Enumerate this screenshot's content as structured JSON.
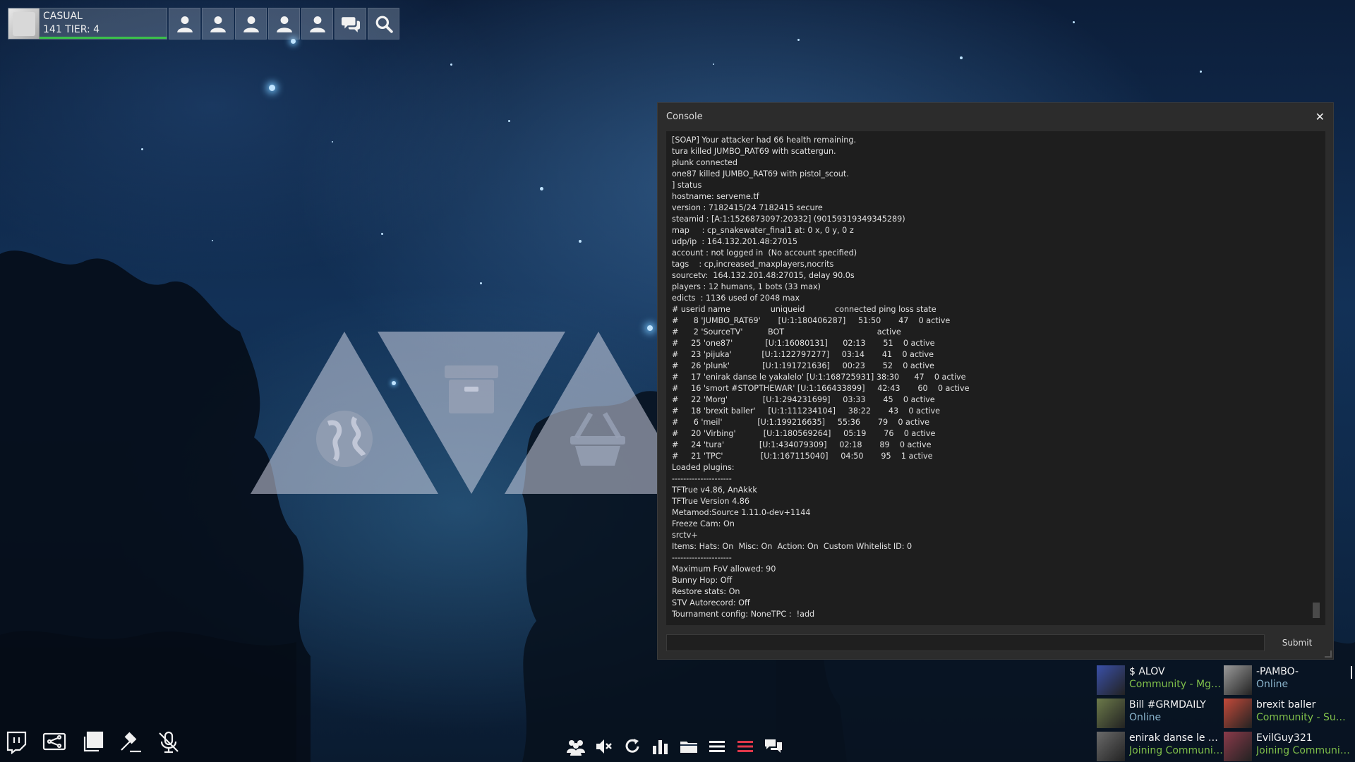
{
  "profile": {
    "mode": "CASUAL",
    "tier": "141 TIER: 4"
  },
  "topbar": {
    "buttons": [
      "person-icon",
      "person-icon",
      "person-icon",
      "person-icon",
      "person-icon",
      "chat-bubbles-icon",
      "search-icon"
    ]
  },
  "console": {
    "title": "Console",
    "close_label": "✕",
    "submit_label": "Submit",
    "input_value": "",
    "lines": [
      "[SOAP] Your attacker had 66 health remaining.",
      "tura killed JUMBO_RAT69 with scattergun.",
      "plunk connected",
      "one87 killed JUMBO_RAT69 with pistol_scout.",
      "] status",
      "hostname: serveme.tf",
      "version : 7182415/24 7182415 secure",
      "steamid : [A:1:1526873097:20332] (90159319349345289)",
      "map     : cp_snakewater_final1 at: 0 x, 0 y, 0 z",
      "udp/ip  : 164.132.201.48:27015",
      "account : not logged in  (No account specified)",
      "tags    : cp,increased_maxplayers,nocrits",
      "sourcetv:  164.132.201.48:27015, delay 90.0s",
      "players : 12 humans, 1 bots (33 max)",
      "edicts  : 1136 used of 2048 max",
      "# userid name                uniqueid            connected ping loss state",
      "#      8 'JUMBO_RAT69'       [U:1:180406287]     51:50       47    0 active",
      "#      2 'SourceTV'          BOT                                     active",
      "#     25 'one87'             [U:1:16080131]      02:13       51    0 active",
      "#     23 'pijuka'            [U:1:122797277]     03:14       41    0 active",
      "#     26 'plunk'             [U:1:191721636]     00:23       52    0 active",
      "#     17 'enirak danse le yakalelo' [U:1:168725931] 38:30      47    0 active",
      "#     16 'smort #STOPTHEWAR' [U:1:166433899]     42:43       60    0 active",
      "#     22 'Morg'              [U:1:294231699]     03:33       45    0 active",
      "#     18 'brexit baller'     [U:1:111234104]     38:22       43    0 active",
      "#      6 'meil'              [U:1:199216635]     55:36       79    0 active",
      "#     20 'Virbing'           [U:1:180569264]     05:19       76    0 active",
      "#     24 'tura'              [U:1:434079309]     02:18       89    0 active",
      "#     21 'TPC'               [U:1:167115040]     04:50       95    1 active",
      "Loaded plugins:",
      "---------------------",
      "TFTrue v4.86, AnAkkk",
      "TFTrue Version 4.86",
      "Metamod:Source 1.11.0-dev+1144",
      "Freeze Cam: On",
      "srctv+",
      "Items: Hats: On  Misc: On  Action: On  Custom Whitelist ID: 0",
      "---------------------",
      "Maximum FoV allowed: 90",
      "Bunny Hop: Off",
      "Restore stats: On",
      "STV Autorecord: Off",
      "Tournament config: NoneTPC :  !add"
    ]
  },
  "friends": [
    {
      "name": "$ ALOV",
      "status": "Community - Mge ...",
      "kind": "community",
      "color": "#3a50a8"
    },
    {
      "name": "-PAMBO-",
      "status": "Online",
      "kind": "online",
      "color": "#9a9a9a"
    },
    {
      "name": "Bill #GRMDAILY",
      "status": "Online",
      "kind": "online",
      "color": "#6c7a4a"
    },
    {
      "name": "brexit baller",
      "status": "Community - Suns...",
      "kind": "community",
      "color": "#c44a3a"
    },
    {
      "name": "enirak danse le yak...",
      "status": "Joining Communit...",
      "kind": "community",
      "color": "#6a6a6a"
    },
    {
      "name": "EvilGuy321",
      "status": "Joining Communit...",
      "kind": "community",
      "color": "#8a3a4a"
    }
  ],
  "bottom_left": [
    "twitch-icon",
    "network-screen-icon",
    "copy-windows-icon",
    "gavel-icon",
    "mic-muted-icon"
  ],
  "bottom_center": [
    "friends-icon",
    "mute-icon",
    "refresh-icon",
    "stats-icon",
    "folder-icon",
    "menu-icon",
    "red-menu-icon",
    "chat-icon"
  ],
  "colors": {
    "accent_green": "#3bc04a",
    "status_community": "#7fbf4a",
    "status_online": "#8ab4cc",
    "red_icon": "#e0384a"
  }
}
